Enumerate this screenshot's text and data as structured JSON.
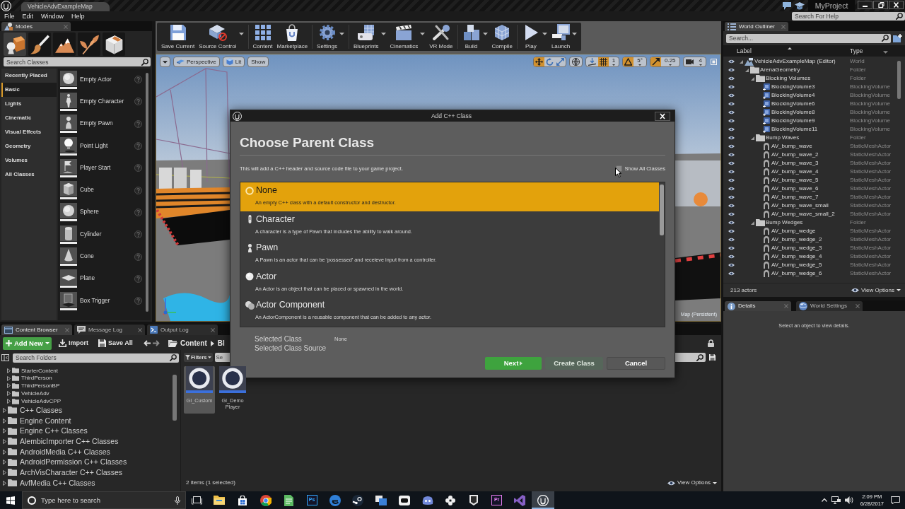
{
  "title_bar": {
    "tab": "VehicleAdvExampleMap",
    "project": "MyProject"
  },
  "menu_bar": {
    "items": [
      "File",
      "Edit",
      "Window",
      "Help"
    ],
    "help_search": {
      "placeholder": "Search For Help"
    }
  },
  "modes_panel": {
    "tab": "Modes",
    "modes": [
      {
        "kind": "place",
        "selected": true
      },
      {
        "kind": "paint",
        "selected": false
      },
      {
        "kind": "landscape",
        "selected": false
      },
      {
        "kind": "foliage",
        "selected": false
      },
      {
        "kind": "geometry",
        "selected": false
      }
    ],
    "search": {
      "placeholder": "Search Classes"
    },
    "categories": [
      {
        "label": "Recently Placed",
        "selected": false
      },
      {
        "label": "Basic",
        "selected": true
      },
      {
        "label": "Lights",
        "selected": false
      },
      {
        "label": "Cinematic",
        "selected": false
      },
      {
        "label": "Visual Effects",
        "selected": false
      },
      {
        "label": "Geometry",
        "selected": false
      },
      {
        "label": "Volumes",
        "selected": false
      },
      {
        "label": "All Classes",
        "selected": false
      }
    ],
    "items": [
      {
        "label": "Empty Actor",
        "kind": "sphere"
      },
      {
        "label": "Empty Character",
        "kind": "figure"
      },
      {
        "label": "Empty Pawn",
        "kind": "pawn"
      },
      {
        "label": "Point Light",
        "kind": "bulb"
      },
      {
        "label": "Player Start",
        "kind": "flag"
      },
      {
        "label": "Cube",
        "kind": "cube"
      },
      {
        "label": "Sphere",
        "kind": "sphere"
      },
      {
        "label": "Cylinder",
        "kind": "cylinder"
      },
      {
        "label": "Cone",
        "kind": "cone"
      },
      {
        "label": "Plane",
        "kind": "plane"
      },
      {
        "label": "Box Trigger",
        "kind": "trigger"
      }
    ]
  },
  "toolbar": {
    "groups": [
      [
        {
          "label": "Save Current",
          "kind": "save",
          "dropdown": false
        },
        {
          "label": "Source Control",
          "kind": "source",
          "dropdown": true
        }
      ],
      [
        {
          "label": "Content",
          "kind": "content",
          "dropdown": false
        },
        {
          "label": "Marketplace",
          "kind": "market",
          "dropdown": false
        }
      ],
      [
        {
          "label": "Settings",
          "kind": "settings",
          "dropdown": true
        }
      ],
      [
        {
          "label": "Blueprints",
          "kind": "blueprints",
          "dropdown": true
        },
        {
          "label": "Cinematics",
          "kind": "cinematics",
          "dropdown": true
        },
        {
          "label": "VR Mode",
          "kind": "vr",
          "dropdown": false
        }
      ],
      [
        {
          "label": "Build",
          "kind": "build",
          "dropdown": true
        },
        {
          "label": "Compile",
          "kind": "compile",
          "dropdown": false
        }
      ],
      [
        {
          "label": "Play",
          "kind": "play",
          "dropdown": true
        },
        {
          "label": "Launch",
          "kind": "launch",
          "dropdown": true
        }
      ]
    ]
  },
  "viewport": {
    "view_buttons": [
      {
        "label": "Perspective",
        "kind": "perspective"
      },
      {
        "label": "Lit",
        "kind": "lit"
      },
      {
        "label": "Show",
        "kind": "show"
      }
    ],
    "transform_tools": [
      {
        "kind": "move",
        "selected": true
      },
      {
        "kind": "rotate",
        "selected": false
      },
      {
        "kind": "scale",
        "selected": false
      }
    ],
    "snaps": [
      {
        "kind": "grid",
        "on": true,
        "value": "1"
      },
      {
        "kind": "rotation",
        "on": true,
        "value": "5°"
      },
      {
        "kind": "scale",
        "on": true,
        "value": "0.25"
      }
    ],
    "camera_speed": "4",
    "level_label": "Map (Persistent)"
  },
  "world_outliner": {
    "tab": "World Outliner",
    "search": {
      "placeholder": "Search..."
    },
    "columns": [
      "Label",
      "Type"
    ],
    "rows": [
      {
        "label": "VehicleAdvExampleMap (Editor)",
        "type": "World",
        "kind": "world",
        "expanded": true,
        "children": [
          {
            "label": "ArenaGeometry",
            "type": "Folder",
            "kind": "folder",
            "expanded": true,
            "children": [
              {
                "label": "Blocking Volumes",
                "type": "Folder",
                "kind": "folder",
                "expanded": true,
                "children": [
                  {
                    "label": "BlockingVolume3",
                    "type": "BlockingVolume",
                    "kind": "volume"
                  },
                  {
                    "label": "BlockingVolume4",
                    "type": "BlockingVolume",
                    "kind": "volume"
                  },
                  {
                    "label": "BlockingVolume6",
                    "type": "BlockingVolume",
                    "kind": "volume"
                  },
                  {
                    "label": "BlockingVolume8",
                    "type": "BlockingVolume",
                    "kind": "volume"
                  },
                  {
                    "label": "BlockingVolume9",
                    "type": "BlockingVolume",
                    "kind": "volume"
                  },
                  {
                    "label": "BlockingVolume11",
                    "type": "BlockingVolume",
                    "kind": "volume"
                  }
                ]
              },
              {
                "label": "Bump Waves",
                "type": "Folder",
                "kind": "folder",
                "expanded": true,
                "children": [
                  {
                    "label": "AV_bump_wave",
                    "type": "StaticMeshActor",
                    "kind": "mesh"
                  },
                  {
                    "label": "AV_bump_wave_2",
                    "type": "StaticMeshActor",
                    "kind": "mesh"
                  },
                  {
                    "label": "AV_bump_wave_3",
                    "type": "StaticMeshActor",
                    "kind": "mesh"
                  },
                  {
                    "label": "AV_bump_wave_4",
                    "type": "StaticMeshActor",
                    "kind": "mesh"
                  },
                  {
                    "label": "AV_bump_wave_5",
                    "type": "StaticMeshActor",
                    "kind": "mesh"
                  },
                  {
                    "label": "AV_bump_wave_6",
                    "type": "StaticMeshActor",
                    "kind": "mesh"
                  },
                  {
                    "label": "AV_bump_wave_7",
                    "type": "StaticMeshActor",
                    "kind": "mesh"
                  },
                  {
                    "label": "AV_bump_wave_small",
                    "type": "StaticMeshActor",
                    "kind": "mesh"
                  },
                  {
                    "label": "AV_bump_wave_small_2",
                    "type": "StaticMeshActor",
                    "kind": "mesh"
                  }
                ]
              },
              {
                "label": "Bump Wedges",
                "type": "Folder",
                "kind": "folder",
                "expanded": true,
                "children": [
                  {
                    "label": "AV_bump_wedge",
                    "type": "StaticMeshActor",
                    "kind": "mesh"
                  },
                  {
                    "label": "AV_bump_wedge_2",
                    "type": "StaticMeshActor",
                    "kind": "mesh"
                  },
                  {
                    "label": "AV_bump_wedge_3",
                    "type": "StaticMeshActor",
                    "kind": "mesh"
                  },
                  {
                    "label": "AV_bump_wedge_4",
                    "type": "StaticMeshActor",
                    "kind": "mesh"
                  },
                  {
                    "label": "AV_bump_wedge_5",
                    "type": "StaticMeshActor",
                    "kind": "mesh"
                  },
                  {
                    "label": "AV_bump_wedge_6",
                    "type": "StaticMeshActor",
                    "kind": "mesh"
                  }
                ]
              }
            ]
          }
        ]
      }
    ],
    "footer": "213 actors",
    "view_options": "View Options"
  },
  "details": {
    "tabs": [
      {
        "label": "Details",
        "selected": true
      },
      {
        "label": "World Settings",
        "selected": false
      }
    ],
    "message": "Select an object to view details."
  },
  "content_browser": {
    "tabs": [
      {
        "label": "Content Browser",
        "selected": true
      },
      {
        "label": "Message Log",
        "selected": false
      },
      {
        "label": "Output Log",
        "selected": false
      }
    ],
    "add_new": "Add New",
    "import": "Import",
    "save_all": "Save All",
    "path": [
      "Content",
      "Bl"
    ],
    "folder_search": {
      "placeholder": "Search Folders"
    },
    "folders": [
      {
        "children": [
          {
            "label": "StarterContent",
            "expanded": false
          },
          {
            "label": "ThirdPerson",
            "expanded": false
          },
          {
            "label": "ThirdPersonBP",
            "expanded": false
          },
          {
            "label": "VehicleAdv",
            "expanded": false
          },
          {
            "label": "VehicleAdvCPP",
            "expanded": false
          }
        ]
      },
      {
        "label": "C++ Classes",
        "expanded": false
      },
      {
        "label": "Engine Content",
        "expanded": false
      },
      {
        "label": "Engine C++ Classes",
        "expanded": false
      },
      {
        "label": "AlembicImporter C++ Classes",
        "expanded": false
      },
      {
        "label": "AndroidMedia C++ Classes",
        "expanded": false
      },
      {
        "label": "AndroidPermission C++ Classes",
        "expanded": false
      },
      {
        "label": "ArchVisCharacter C++ Classes",
        "expanded": false
      },
      {
        "label": "AvfMedia C++ Classes",
        "expanded": false
      }
    ],
    "filters": "Filters",
    "asset_search": {
      "placeholder": "Se"
    },
    "assets": [
      {
        "label": "GI_Custom",
        "selected": true
      },
      {
        "label": "GI_Demo Player",
        "selected": false
      }
    ],
    "status": "2 items (1 selected)",
    "view_options": "View Options"
  },
  "dialog": {
    "title": "Add C++ Class",
    "heading": "Choose Parent Class",
    "description": "This will add a C++ header and source code file to your game project.",
    "show_all": {
      "label": "Show All Classes",
      "checked": false
    },
    "classes": [
      {
        "name": "None",
        "description": "An empty C++ class with a default constructor and destructor.",
        "kind": "none",
        "selected": true
      },
      {
        "name": "Character",
        "description": "A character is a type of Pawn that includes the ability to walk around.",
        "kind": "character",
        "selected": false
      },
      {
        "name": "Pawn",
        "description": "A Pawn is an actor that can be 'possessed' and receieve input from a controller.",
        "kind": "pawn",
        "selected": false
      },
      {
        "name": "Actor",
        "description": "An Actor is an object that can be placed or spawned in the world.",
        "kind": "actor",
        "selected": false
      },
      {
        "name": "Actor Component",
        "description": "An ActorComponent is a reusable component that can be added to any actor.",
        "kind": "component",
        "selected": false
      }
    ],
    "summary": [
      {
        "label": "Selected Class",
        "value": "None"
      },
      {
        "label": "Selected Class Source"
      }
    ],
    "buttons": [
      {
        "label": "Next",
        "kind": "next",
        "disabled": false
      },
      {
        "label": "Create Class",
        "kind": "create",
        "disabled": true
      },
      {
        "label": "Cancel",
        "kind": "cancel",
        "disabled": false
      }
    ]
  },
  "taskbar": {
    "search": {
      "placeholder": "Type here to search"
    },
    "apps": [
      {
        "kind": "files",
        "selected": false
      },
      {
        "kind": "store",
        "selected": false
      },
      {
        "kind": "browser",
        "selected": false
      },
      {
        "kind": "notes",
        "selected": false
      },
      {
        "kind": "tile",
        "label": "Ps",
        "color": "#31a8ff",
        "selected": false
      },
      {
        "kind": "web",
        "selected": false
      },
      {
        "kind": "games",
        "selected": false
      },
      {
        "kind": "windows",
        "selected": false
      },
      {
        "kind": "box",
        "selected": false
      },
      {
        "kind": "chat",
        "selected": false
      },
      {
        "kind": "flower",
        "selected": false
      },
      {
        "kind": "shield",
        "selected": false
      },
      {
        "kind": "tile",
        "label": "Pr",
        "color": "#e77cf2",
        "selected": false
      },
      {
        "kind": "studio",
        "selected": false
      },
      {
        "kind": "engine",
        "selected": true
      }
    ],
    "time": "2:09 PM",
    "date": "6/28/2017"
  }
}
